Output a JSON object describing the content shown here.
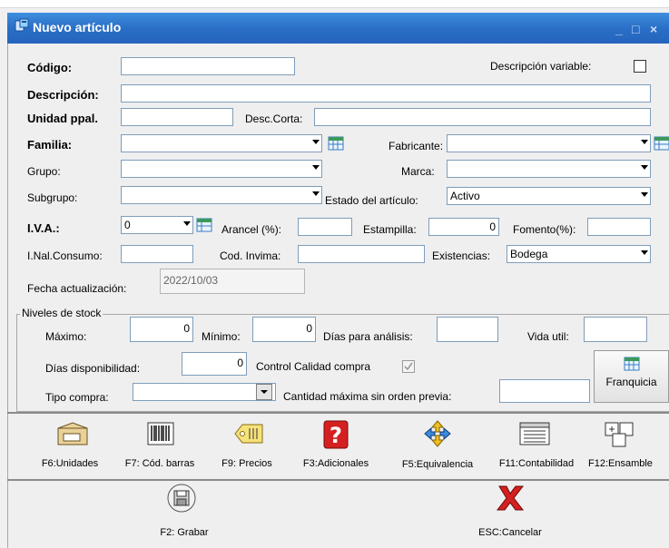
{
  "window": {
    "title": "Nuevo artículo",
    "min_glyph": "_",
    "max_glyph": "□",
    "close_glyph": "×"
  },
  "form": {
    "codigo": {
      "label": "Código:",
      "value": ""
    },
    "desc_variable": {
      "label": "Descripción variable:",
      "checked": false
    },
    "descripcion": {
      "label": "Descripción:",
      "value": ""
    },
    "unidad": {
      "label": "Unidad ppal.",
      "value": ""
    },
    "desc_corta": {
      "label": "Desc.Corta:",
      "value": ""
    },
    "familia": {
      "label": "Familia:",
      "value": ""
    },
    "fabricante": {
      "label": "Fabricante:",
      "value": ""
    },
    "grupo": {
      "label": "Grupo:",
      "value": ""
    },
    "marca": {
      "label": "Marca:",
      "value": ""
    },
    "subgrupo": {
      "label": "Subgrupo:",
      "value": ""
    },
    "estado": {
      "label": "Estado del artículo:",
      "value": "Activo"
    },
    "iva": {
      "label": "I.V.A.:",
      "value": "0"
    },
    "arancel": {
      "label": "Arancel (%):",
      "value": ""
    },
    "estampilla": {
      "label": "Estampilla:",
      "value": "0"
    },
    "fomento": {
      "label": "Fomento(%):",
      "value": ""
    },
    "inal": {
      "label": "I.Nal.Consumo:",
      "value": ""
    },
    "invima": {
      "label": "Cod. Invima:",
      "value": ""
    },
    "existencias": {
      "label": "Existencias:",
      "value": "Bodega"
    },
    "fecha": {
      "label": "Fecha actualización:",
      "value": "2022/10/03"
    }
  },
  "stock": {
    "legend": "Niveles de stock",
    "maximo": {
      "label": "Máximo:",
      "value": "0"
    },
    "minimo": {
      "label": "Mínimo:",
      "value": "0"
    },
    "dias_analisis": {
      "label": "Días para análisis:",
      "value": ""
    },
    "vida_util": {
      "label": "Vida util:",
      "value": ""
    },
    "dias_disp": {
      "label": "Días disponibilidad:",
      "value": "0"
    },
    "control_calidad": {
      "label": "Control Calidad compra",
      "checked": true
    },
    "tipo_compra": {
      "label": "Tipo compra:",
      "value": ""
    },
    "cant_max": {
      "label": "Cantidad máxima sin orden previa:",
      "value": ""
    },
    "franquicia_label": "Franquicia"
  },
  "toolbar": [
    {
      "label": "F6:Unidades",
      "icon": "box-icon"
    },
    {
      "label": "F7: Cód. barras",
      "icon": "barcode-icon"
    },
    {
      "label": "F9: Precios",
      "icon": "price-tag-icon"
    },
    {
      "label": "F3:Adicionales",
      "icon": "question-icon"
    },
    {
      "label": "F5:Equivalencia",
      "icon": "arrows-icon"
    },
    {
      "label": "F11:Contabilidad",
      "icon": "ledger-icon"
    },
    {
      "label": "F12:Ensamble",
      "icon": "assembly-icon"
    }
  ],
  "actions": {
    "save_label": "F2: Grabar",
    "cancel_label": "ESC:Cancelar"
  },
  "colors": {
    "titlebar": "#2a6fc7",
    "border": "#7f9db9",
    "cancel_red": "#d42020"
  }
}
